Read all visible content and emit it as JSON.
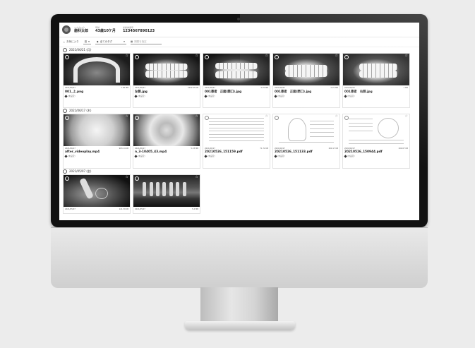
{
  "patient": {
    "name_label": "シカクロウ",
    "name": "歯科太郎",
    "age_label": "年齢",
    "age": "43歳10ケ月",
    "id_label": "診察券番号",
    "id": "1234567890123"
  },
  "toolbar": {
    "favorite": "お気に入り",
    "view": "田",
    "tag_select": "全てのタグ",
    "date_placeholder": "期間を指定"
  },
  "groups": [
    {
      "date": "2021/06/21 (月)",
      "cards": [
        {
          "date": "2021/06/21",
          "size": "7.56 MB",
          "name": "001_上.png",
          "tag": "(未設定)"
        },
        {
          "date": "2021/06/21",
          "size": "1022.55 KB",
          "name": "左側.jpg",
          "tag": "(未設定)"
        },
        {
          "date": "2021/06/21",
          "size": "2.25 MB",
          "name": "001患者　正面(開口).jpg",
          "tag": "(未設定)"
        },
        {
          "date": "2021/06/21",
          "size": "2.25 MB",
          "name": "001患者　正面(閉口).jpg",
          "tag": "(未設定)"
        },
        {
          "date": "2021/06/21",
          "size": "1 MB",
          "name": "001患者　右側.jpg",
          "tag": "(未設定)"
        }
      ]
    },
    {
      "date": "2021/06/17 (木)",
      "cards": [
        {
          "date": "2021/06/17",
          "size": "963.14 KB",
          "name": "after_videoplay.mp4",
          "tag": "(未設定)"
        },
        {
          "date": "2021/06/17",
          "size": "5.23 MB",
          "name": "n_3-10405_43.mp4",
          "tag": "(未設定)"
        },
        {
          "date": "2021/06/17",
          "size": "71.72 KB",
          "name": "20210526_151159.pdf",
          "tag": "(未設定)"
        },
        {
          "date": "2021/06/17",
          "size": "209.17 KB",
          "name": "20210526_151133.pdf",
          "tag": "(未設定)"
        },
        {
          "date": "2021/06/17",
          "size": "209.07 KB",
          "name": "20210526_150944.pdf",
          "tag": "(未設定)"
        }
      ]
    },
    {
      "date": "2021/05/07 (金)",
      "cards": [
        {
          "date": "2021/05/07",
          "size": "121.39 KB",
          "name": "",
          "tag": ""
        },
        {
          "date": "2021/05/07",
          "size": "5.2 MB",
          "name": "",
          "tag": ""
        }
      ]
    }
  ],
  "icons": {
    "favorite": "star-icon",
    "tag": "tag-icon",
    "calendar": "calendar-icon",
    "select": "circle-icon"
  }
}
